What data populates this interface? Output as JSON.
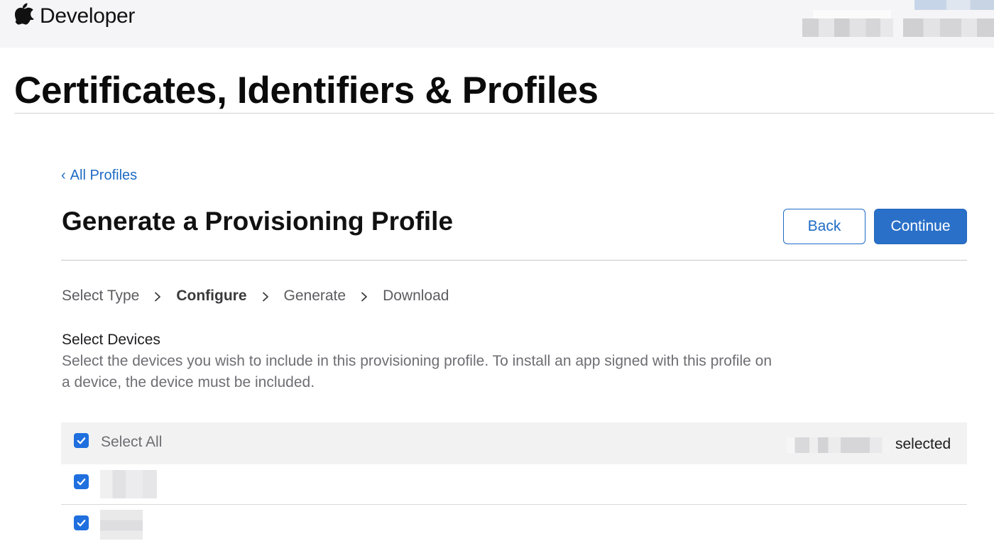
{
  "nav": {
    "brand": "Developer",
    "icons": {
      "logo": "apple-logo-icon"
    }
  },
  "page": {
    "title": "Certificates, Identifiers & Profiles"
  },
  "content": {
    "back_link": "All Profiles",
    "heading": "Generate a Provisioning Profile",
    "buttons": {
      "back": "Back",
      "continue": "Continue"
    },
    "steps": [
      "Select Type",
      "Configure",
      "Generate",
      "Download"
    ],
    "active_step": "Configure",
    "select_devices": {
      "title": "Select Devices",
      "description": "Select the devices you wish to include in this provisioning profile. To install an app signed with this profile on a device, the device must be included."
    }
  },
  "device_table": {
    "select_all_label": "Select All",
    "selected_suffix": "selected",
    "select_all_checked": true,
    "rows": [
      {
        "checked": true
      },
      {
        "checked": true
      }
    ]
  },
  "colors": {
    "link_blue": "#1e6bc4",
    "primary_button": "#2a70c8",
    "checkbox": "#1f6fde",
    "nav_background": "#f5f5f7"
  }
}
